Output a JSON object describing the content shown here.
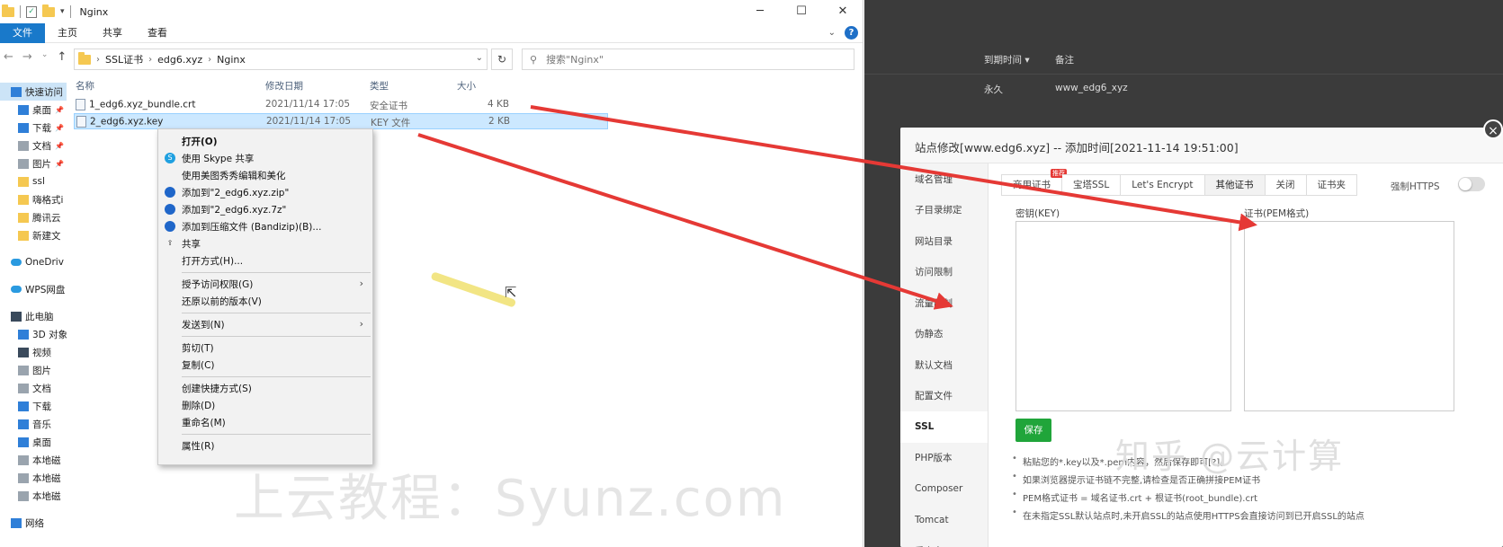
{
  "explorer": {
    "window_title": "Nginx",
    "win_buttons": [
      "─",
      "☐",
      "✕"
    ],
    "ribbon_tabs": [
      "文件",
      "主页",
      "共享",
      "查看"
    ],
    "ribbon_help": "?",
    "address": {
      "crumbs": [
        "SSL证书",
        "edg6.xyz",
        "Nginx"
      ]
    },
    "search_placeholder": "搜索\"Nginx\"",
    "nav_pane": [
      {
        "label": "快速访问",
        "icon": "star-icon"
      },
      {
        "label": "桌面",
        "icon": "desktop-icon"
      },
      {
        "label": "下载",
        "icon": "download-icon"
      },
      {
        "label": "文档",
        "icon": "document-icon"
      },
      {
        "label": "图片",
        "icon": "picture-icon"
      },
      {
        "label": "ssl",
        "icon": "folder-icon"
      },
      {
        "label": "嗨格式i",
        "icon": "folder-icon"
      },
      {
        "label": "腾讯云",
        "icon": "folder-icon"
      },
      {
        "label": "新建文",
        "icon": "folder-icon"
      },
      {
        "label": "OneDriv",
        "icon": "cloud-icon"
      },
      {
        "label": "WPS网盘",
        "icon": "cloud-icon"
      },
      {
        "label": "此电脑",
        "icon": "computer-icon"
      },
      {
        "label": "3D 对象",
        "icon": "cube-icon"
      },
      {
        "label": "视频",
        "icon": "video-icon"
      },
      {
        "label": "图片",
        "icon": "picture-icon"
      },
      {
        "label": "文档",
        "icon": "document-icon"
      },
      {
        "label": "下载",
        "icon": "download-icon"
      },
      {
        "label": "音乐",
        "icon": "music-icon"
      },
      {
        "label": "桌面",
        "icon": "desktop-icon"
      },
      {
        "label": "本地磁",
        "icon": "drive-icon"
      },
      {
        "label": "本地磁",
        "icon": "drive-icon"
      },
      {
        "label": "本地磁",
        "icon": "drive-icon"
      },
      {
        "label": "网络",
        "icon": "network-icon"
      }
    ],
    "columns": [
      "名称",
      "修改日期",
      "类型",
      "大小"
    ],
    "files": [
      {
        "name": "1_edg6.xyz_bundle.crt",
        "date": "2021/11/14 17:05",
        "type": "安全证书",
        "size": "4 KB"
      },
      {
        "name": "2_edg6.xyz.key",
        "date": "2021/11/14 17:05",
        "type": "KEY 文件",
        "size": "2 KB"
      }
    ],
    "context_menu": [
      {
        "label": "打开(O)",
        "bold": true
      },
      {
        "label": "使用 Skype 共享",
        "icon": "S"
      },
      {
        "label": "使用美图秀秀编辑和美化"
      },
      {
        "label": "添加到\"2_edg6.xyz.zip\"",
        "icon": "●"
      },
      {
        "label": "添加到\"2_edg6.xyz.7z\"",
        "icon": "●"
      },
      {
        "label": "添加到压缩文件 (Bandizip)(B)...",
        "icon": "●"
      },
      {
        "label": "共享",
        "icon": "share"
      },
      {
        "label": "打开方式(H)..."
      },
      {
        "sep": true
      },
      {
        "label": "授予访问权限(G)",
        "submenu": true
      },
      {
        "label": "还原以前的版本(V)"
      },
      {
        "sep": true
      },
      {
        "label": "发送到(N)",
        "submenu": true
      },
      {
        "sep": true
      },
      {
        "label": "剪切(T)"
      },
      {
        "label": "复制(C)"
      },
      {
        "sep": true
      },
      {
        "label": "创建快捷方式(S)"
      },
      {
        "label": "删除(D)"
      },
      {
        "label": "重命名(M)"
      },
      {
        "sep": true
      },
      {
        "label": "属性(R)"
      }
    ],
    "watermark": "上云教程：Syunz.com"
  },
  "bt": {
    "table_header": {
      "expire": "到期时间 ▾",
      "note": "备注"
    },
    "table_row": {
      "expire": "永久",
      "note": "www_edg6_xyz"
    },
    "modal": {
      "title": "站点修改[www.edg6.xyz] -- 添加时间[2021-11-14 19:51:00]",
      "close": "×",
      "menu": [
        "域名管理",
        "子目录绑定",
        "网站目录",
        "访问限制",
        "流量限制",
        "伪静态",
        "默认文档",
        "配置文件",
        "SSL",
        "PHP版本",
        "Composer",
        "Tomcat",
        "重定向"
      ],
      "active_menu": "SSL",
      "tabs": [
        "商用证书",
        "宝塔SSL",
        "Let's Encrypt",
        "其他证书",
        "关闭",
        "证书夹"
      ],
      "active_tab": "其他证书",
      "tab_badge": "推荐",
      "force_https": "强制HTTPS",
      "key_label": "密钥(KEY)",
      "cert_label": "证书(PEM格式)",
      "save": "保存",
      "tips": [
        "粘贴您的*.key以及*.pem内容，然后保存即可[?]。",
        "如果浏览器提示证书链不完整,请检查是否正确拼接PEM证书",
        "PEM格式证书 = 域名证书.crt + 根证书(root_bundle).crt",
        "在未指定SSL默认站点时,未开启SSL的站点使用HTTPS会直接访问到已开启SSL的站点"
      ]
    },
    "zhihu_watermark": "知乎 @云计算"
  },
  "colors": {
    "ribbon_active": "#1979ca",
    "selection": "#cce8ff",
    "bt_green": "#20a53a",
    "arrow_red": "#e53935",
    "dark_bg": "#3b3b3b"
  }
}
